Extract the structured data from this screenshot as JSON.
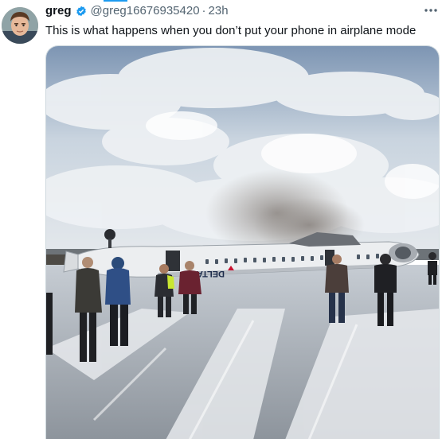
{
  "author": {
    "display_name": "greg",
    "handle": "@greg16676935420",
    "separator": "·",
    "timestamp": "23h",
    "verified_icon": "verified-badge-icon",
    "avatar_icon": "avatar-photo"
  },
  "tweet": {
    "text": "This is what happens when you don’t put your phone in airplane mode",
    "more_icon": "more-options-icon"
  },
  "media": {
    "description_icon": "photo-airplane-crash",
    "aircraft_livery_text": "DELTA"
  },
  "colors": {
    "accent": "#1d9bf0",
    "text_primary": "#0f1419",
    "text_secondary": "#536471"
  }
}
